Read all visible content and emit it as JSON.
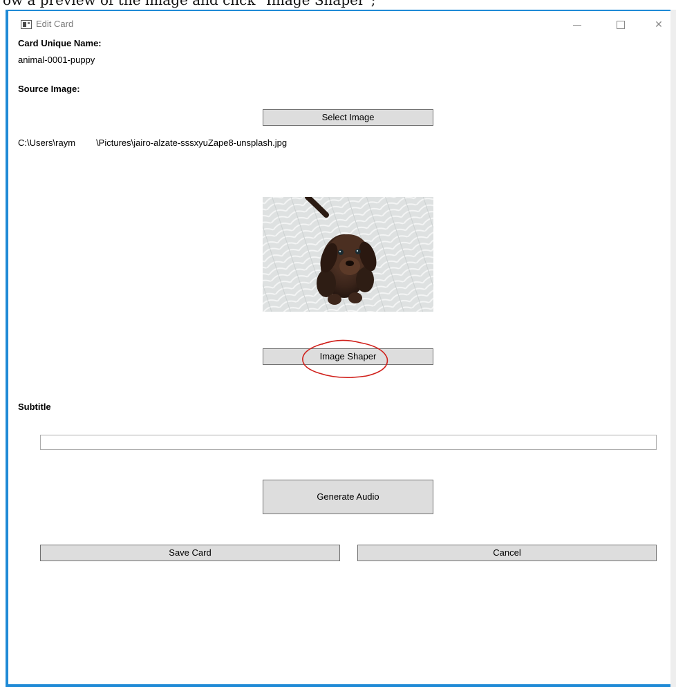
{
  "caption": {
    "text": "ow a preview of the image and click \"Image Shaper\";"
  },
  "window": {
    "title": "Edit Card",
    "controls": {
      "minimize": "—",
      "maximize": "□",
      "close": "✕"
    },
    "accent_color": "#1f8ad6"
  },
  "form": {
    "card_name_label": "Card Unique Name:",
    "card_name_value": "animal-0001-puppy",
    "source_image_label": "Source Image:",
    "select_image_button": "Select Image",
    "source_path_prefix": "C:\\Users\\raym",
    "source_path_suffix": "\\Pictures\\jairo-alzate-sssxyuZape8-unsplash.jpg",
    "preview_icon": "puppy-photo",
    "image_shaper_button": "Image Shaper",
    "annotation_color": "#d0201b",
    "subtitle_label": "Subtitle",
    "subtitle_value": "",
    "generate_audio_button": "Generate Audio",
    "save_card_button": "Save Card",
    "cancel_button": "Cancel"
  }
}
